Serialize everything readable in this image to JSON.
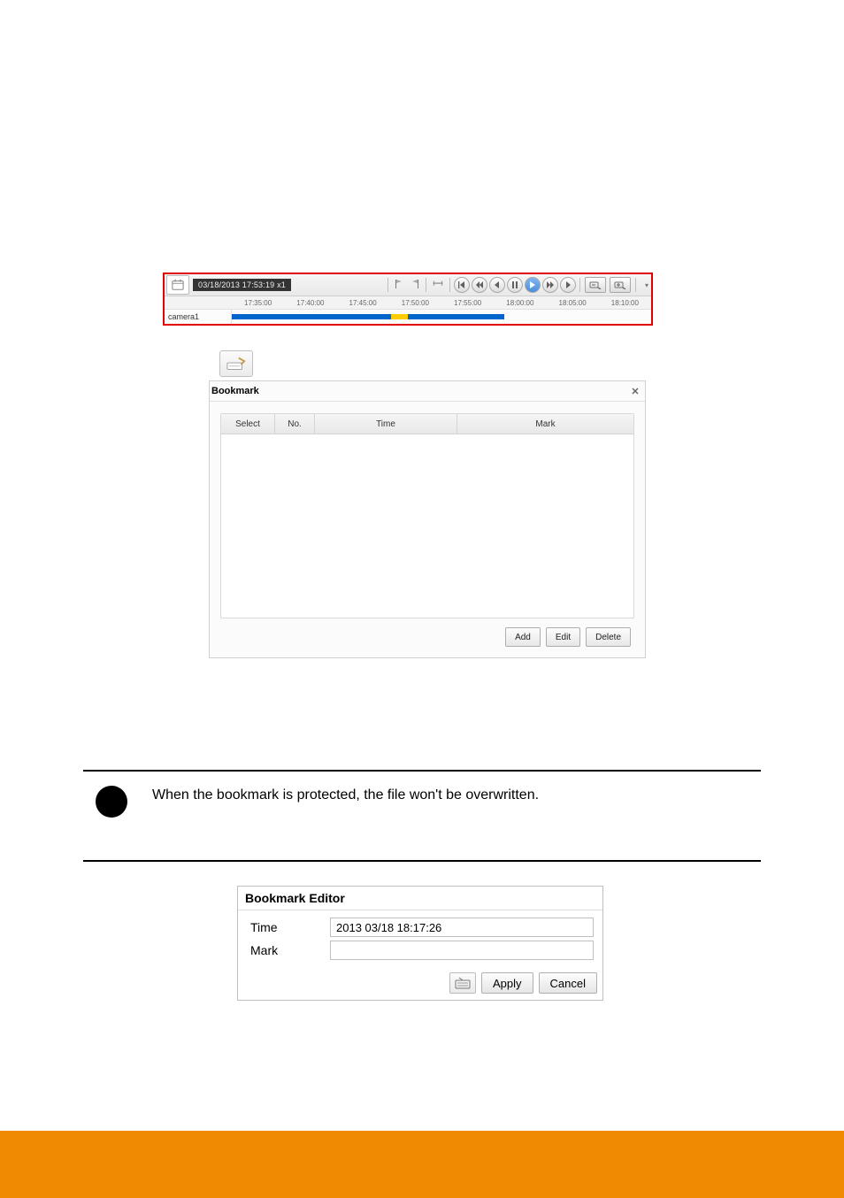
{
  "timeline": {
    "timestamp": "03/18/2013 17:53:19 x1",
    "ticks": [
      "17:35:00",
      "17:40:00",
      "17:45:00",
      "17:50:00",
      "17:55:00",
      "18:00:00",
      "18:05:00",
      "18:10:00"
    ],
    "channel_label": "camera1",
    "segments": [
      {
        "start_pct": 0,
        "width_pct": 38,
        "kind": "blue"
      },
      {
        "start_pct": 38,
        "width_pct": 4,
        "kind": "yellow"
      },
      {
        "start_pct": 42,
        "width_pct": 23,
        "kind": "blue"
      }
    ]
  },
  "bookmark_panel": {
    "title": "Bookmark",
    "columns": {
      "select": "Select",
      "no": "No.",
      "time": "Time",
      "mark": "Mark"
    },
    "rows": [],
    "actions": {
      "add": "Add",
      "edit": "Edit",
      "delete": "Delete"
    }
  },
  "note": {
    "text": "When the bookmark is protected, the file won't be overwritten."
  },
  "editor": {
    "title": "Bookmark Editor",
    "time_label": "Time",
    "time_value": "2013  03/18   18:17:26",
    "mark_label": "Mark",
    "mark_value": "",
    "apply": "Apply",
    "cancel": "Cancel"
  }
}
